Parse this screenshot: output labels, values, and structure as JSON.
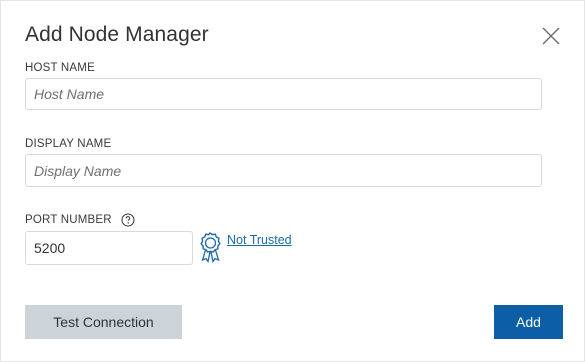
{
  "dialog": {
    "title": "Add Node Manager",
    "close_icon": "close-icon"
  },
  "fields": {
    "host": {
      "label": "HOST NAME",
      "placeholder": "Host Name",
      "value": ""
    },
    "display": {
      "label": "DISPLAY NAME",
      "placeholder": "Display Name",
      "value": ""
    },
    "port": {
      "label": "PORT NUMBER",
      "value": "5200",
      "help_icon": "question-circle-icon"
    }
  },
  "trust": {
    "icon": "ribbon-badge-icon",
    "link_text": "Not Trusted",
    "color": "#1b6ba9"
  },
  "buttons": {
    "test_connection": "Test Connection",
    "add": "Add"
  },
  "colors": {
    "primary": "#0c5fa6",
    "secondary": "#ccd4da"
  }
}
